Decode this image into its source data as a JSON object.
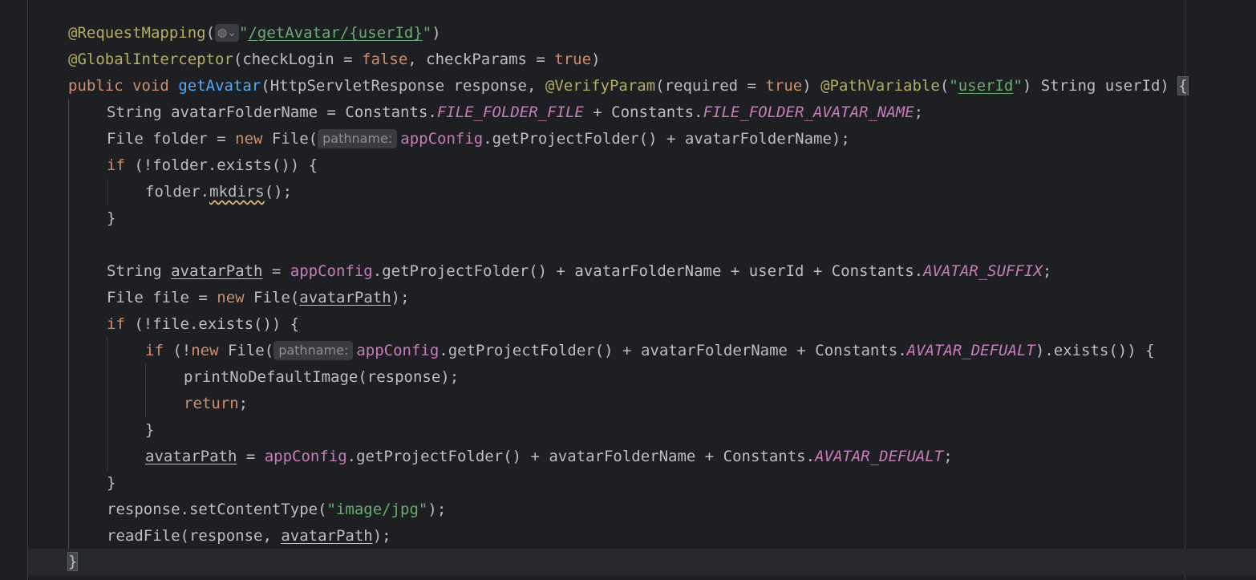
{
  "editor": {
    "hint_label": "pathname:",
    "globe_icon": "globe-icon",
    "lines": {
      "l1": {
        "ann": "@RequestMapping",
        "open": "(",
        "str_q1": "\"",
        "str_path": "/getAvatar/{userId}",
        "str_q2": "\"",
        "close": ")"
      },
      "l2": {
        "ann": "@GlobalInterceptor",
        "a": "(checkLogin = ",
        "kw1": "false",
        "b": ", checkParams = ",
        "kw2": "true",
        "c": ")"
      },
      "l3": {
        "kw1": "public",
        "kw2": "void",
        "fn": "getAvatar",
        "a": "(HttpServletResponse response, ",
        "ann1": "@VerifyParam",
        "b": "(required = ",
        "kw3": "true",
        "c": ") ",
        "ann2": "@PathVariable",
        "d": "(",
        "str_q1": "\"",
        "str_id": "userId",
        "str_q2": "\"",
        "e": ") String userId) ",
        "brace": "{"
      },
      "l4": {
        "a": "String avatarFolderName = Constants.",
        "c1": "FILE_FOLDER_FILE",
        "b": " + Constants.",
        "c2": "FILE_FOLDER_AVATAR_NAME",
        "c": ";"
      },
      "l5": {
        "a": "File folder = ",
        "kw": "new",
        "b": " File(",
        "field": "appConfig",
        "c": ".getProjectFolder() + avatarFolderName);"
      },
      "l6": {
        "kw": "if",
        "a": " (!folder.exists()) {"
      },
      "l7": {
        "a": "folder.",
        "warn": "mkdirs",
        "b": "();"
      },
      "l8": {
        "a": "}"
      },
      "l9": {
        "a": "String ",
        "ul": "avatarPath",
        "b": " = ",
        "field": "appConfig",
        "c": ".getProjectFolder() + avatarFolderName + userId + Constants.",
        "const": "AVATAR_SUFFIX",
        "d": ";"
      },
      "l10": {
        "a": "File file = ",
        "kw": "new",
        "b": " File(",
        "ul": "avatarPath",
        "c": ");"
      },
      "l11": {
        "kw": "if",
        "a": " (!file.exists()) {"
      },
      "l12": {
        "kw1": "if",
        "a": " (!",
        "kw2": "new",
        "b": " File(",
        "field": "appConfig",
        "c": ".getProjectFolder() + avatarFolderName + Constants.",
        "const": "AVATAR_DEFUALT",
        "d": ").exists()) {"
      },
      "l13": {
        "a": "printNoDefaultImage(response);"
      },
      "l14": {
        "kw": "return",
        "a": ";"
      },
      "l15": {
        "a": "}"
      },
      "l16": {
        "ul": "avatarPath",
        "a": " = ",
        "field": "appConfig",
        "b": ".getProjectFolder() + avatarFolderName + Constants.",
        "const": "AVATAR_DEFUALT",
        "c": ";"
      },
      "l17": {
        "a": "}"
      },
      "l18": {
        "a": "response.setContentType(",
        "str": "\"image/jpg\"",
        "b": ");"
      },
      "l19": {
        "a": "readFile(response, ",
        "ul": "avatarPath",
        "b": ");"
      },
      "l20": {
        "brace": "}"
      }
    }
  }
}
